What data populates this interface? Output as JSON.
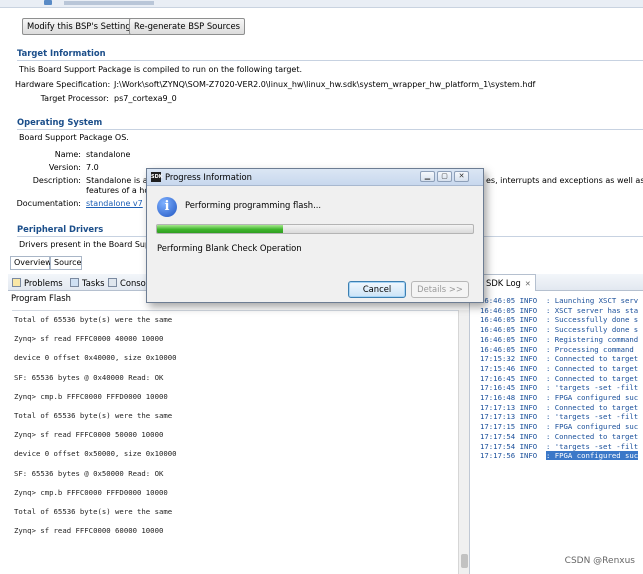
{
  "bsp": {
    "buttons": {
      "modify": "Modify this BSP's Settings",
      "regenerate": "Re-generate BSP Sources"
    },
    "target_info": {
      "title": "Target Information",
      "description": "This Board Support Package is compiled to run on the following target.",
      "hw_spec_label": "Hardware Specification:",
      "hw_spec_value": "J:\\Work\\soft\\ZYNQ\\SOM-Z7020-VER2.0\\linux_hw\\linux_hw.sdk\\system_wrapper_hw_platform_1\\system.hdf",
      "processor_label": "Target Processor:",
      "processor_value": "ps7_cortexa9_0"
    },
    "os": {
      "title": "Operating System",
      "description": "Board Support Package OS.",
      "name_label": "Name:",
      "name_value": "standalone",
      "version_label": "Version:",
      "version_value": "7.0",
      "desc_label": "Description:",
      "desc_value_1": "Standalone is a",
      "desc_value_tail": "es, interrupts and exceptions as well as th",
      "desc_value_2": "features of a ho",
      "doc_label": "Documentation:",
      "doc_link": "standalone v7"
    },
    "peripheral": {
      "title": "Peripheral Drivers",
      "description": "Drivers present in the Board Sup"
    },
    "tabs": [
      "Overview",
      "Source"
    ]
  },
  "left_pane": {
    "tabs": {
      "problems": "Problems",
      "tasks": "Tasks",
      "console": "Conso"
    },
    "console_title": "Program Flash",
    "lines": [
      "Total of 65536 byte(s) were the same",
      "",
      "Zynq> sf read FFFC0000 40000 10000",
      "",
      "device 0 offset 0x40000, size 0x10000",
      "",
      "SF: 65536 bytes @ 0x40000 Read: OK",
      "",
      "Zynq> cmp.b FFFC0000 FFFD0000 10000",
      "",
      "Total of 65536 byte(s) were the same",
      "",
      "Zynq> sf read FFFC0000 50000 10000",
      "",
      "device 0 offset 0x50000, size 0x10000",
      "",
      "SF: 65536 bytes @ 0x50000 Read: OK",
      "",
      "Zynq> cmp.b FFFC0000 FFFD0000 10000",
      "",
      "Total of 65536 byte(s) were the same",
      "",
      "Zynq> sf read FFFC0000 60000 10000"
    ]
  },
  "sdk_log": {
    "tab": "SDK Log",
    "rows": [
      {
        "time": "16:46:05",
        "level": "INFO",
        "msg": ": Launching XSCT serv"
      },
      {
        "time": "16:46:05",
        "level": "INFO",
        "msg": ": XSCT server has sta"
      },
      {
        "time": "16:46:05",
        "level": "INFO",
        "msg": ": Successfully done s"
      },
      {
        "time": "16:46:05",
        "level": "INFO",
        "msg": ": Successfully done s"
      },
      {
        "time": "16:46:05",
        "level": "INFO",
        "msg": ": Registering command"
      },
      {
        "time": "16:46:05",
        "level": "INFO",
        "msg": ": Processing command "
      },
      {
        "time": "17:15:32",
        "level": "INFO",
        "msg": ": Connected to target"
      },
      {
        "time": "17:15:46",
        "level": "INFO",
        "msg": ": Connected to target"
      },
      {
        "time": "17:16:45",
        "level": "INFO",
        "msg": ": Connected to target"
      },
      {
        "time": "17:16:45",
        "level": "INFO",
        "msg": ": 'targets -set -filt"
      },
      {
        "time": "17:16:48",
        "level": "INFO",
        "msg": ": FPGA configured suc"
      },
      {
        "time": "17:17:13",
        "level": "INFO",
        "msg": ": Connected to target"
      },
      {
        "time": "17:17:13",
        "level": "INFO",
        "msg": ": 'targets -set -filt"
      },
      {
        "time": "17:17:15",
        "level": "INFO",
        "msg": ": FPGA configured suc"
      },
      {
        "time": "17:17:54",
        "level": "INFO",
        "msg": ": Connected to target"
      },
      {
        "time": "17:17:54",
        "level": "INFO",
        "msg": ": 'targets -set -filt"
      },
      {
        "time": "17:17:56",
        "level": "INFO",
        "msg": ": FPGA configured suc"
      }
    ]
  },
  "dialog": {
    "title": "Progress Information",
    "app_icon_text": "SDK",
    "message": "Performing programming flash...",
    "operation": "Performing Blank Check Operation",
    "progress": 0.4,
    "cancel": "Cancel",
    "details": "Details >>",
    "progress_color": "#3fb52c"
  },
  "watermark": "CSDN @Renxus"
}
